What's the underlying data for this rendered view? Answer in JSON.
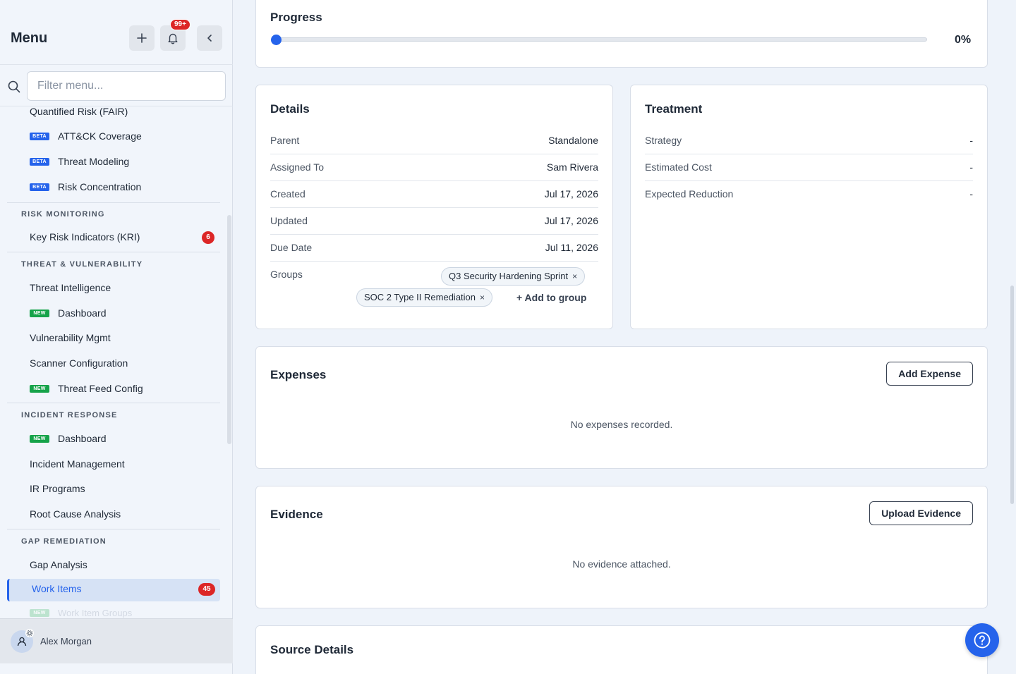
{
  "sidebar": {
    "title": "Menu",
    "notif_count": "99+",
    "search_placeholder": "Filter menu...",
    "items_top": [
      {
        "label": "Quantified Risk (FAIR)"
      },
      {
        "label": "ATT&CK Coverage",
        "tag": "BETA"
      },
      {
        "label": "Threat Modeling",
        "tag": "BETA"
      },
      {
        "label": "Risk Concentration",
        "tag": "BETA"
      }
    ],
    "sections": [
      {
        "heading": "RISK MONITORING",
        "items": [
          {
            "label": "Key Risk Indicators (KRI)",
            "count": "6"
          }
        ]
      },
      {
        "heading": "THREAT & VULNERABILITY",
        "items": [
          {
            "label": "Threat Intelligence"
          },
          {
            "label": "Dashboard",
            "tag": "NEW"
          },
          {
            "label": "Vulnerability Mgmt"
          },
          {
            "label": "Scanner Configuration"
          },
          {
            "label": "Threat Feed Config",
            "tag": "NEW"
          }
        ]
      },
      {
        "heading": "INCIDENT RESPONSE",
        "items": [
          {
            "label": "Dashboard",
            "tag": "NEW"
          },
          {
            "label": "Incident Management"
          },
          {
            "label": "IR Programs"
          },
          {
            "label": "Root Cause Analysis"
          }
        ]
      },
      {
        "heading": "GAP REMEDIATION",
        "items": [
          {
            "label": "Gap Analysis"
          },
          {
            "label": "Work Items",
            "count": "45",
            "active": true
          },
          {
            "label": "Work Item Groups",
            "tag": "NEW"
          }
        ]
      }
    ],
    "user": {
      "name": "Alex Morgan"
    }
  },
  "progress": {
    "title": "Progress",
    "percent_label": "0%",
    "value": 0
  },
  "details": {
    "title": "Details",
    "rows": [
      {
        "label": "Parent",
        "value": "Standalone"
      },
      {
        "label": "Assigned To",
        "value": "Sam Rivera"
      },
      {
        "label": "Created",
        "value": "Jul 17, 2026"
      },
      {
        "label": "Updated",
        "value": "Jul 17, 2026"
      },
      {
        "label": "Due Date",
        "value": "Jul 11, 2026"
      }
    ],
    "groups_label": "Groups",
    "groups": [
      "Q3 Security Hardening Sprint",
      "SOC 2 Type II Remediation"
    ],
    "add_to_group": "+ Add to group",
    "chip_remove": "×"
  },
  "treatment": {
    "title": "Treatment",
    "rows": [
      {
        "label": "Strategy",
        "value": "-"
      },
      {
        "label": "Estimated Cost",
        "value": "-"
      },
      {
        "label": "Expected Reduction",
        "value": "-"
      }
    ]
  },
  "expenses": {
    "title": "Expenses",
    "button": "Add Expense",
    "empty": "No expenses recorded."
  },
  "evidence": {
    "title": "Evidence",
    "button": "Upload Evidence",
    "empty": "No evidence attached."
  },
  "source": {
    "title": "Source Details"
  },
  "icons": {
    "add": "plus-icon",
    "bell": "bell-icon",
    "collapse": "chevron-left-icon",
    "search": "search-icon",
    "user": "user-icon",
    "settings": "gear-icon",
    "help": "help-icon"
  },
  "colors": {
    "accent": "#2563eb",
    "danger": "#dc2626",
    "new_tag": "#16a34a"
  }
}
